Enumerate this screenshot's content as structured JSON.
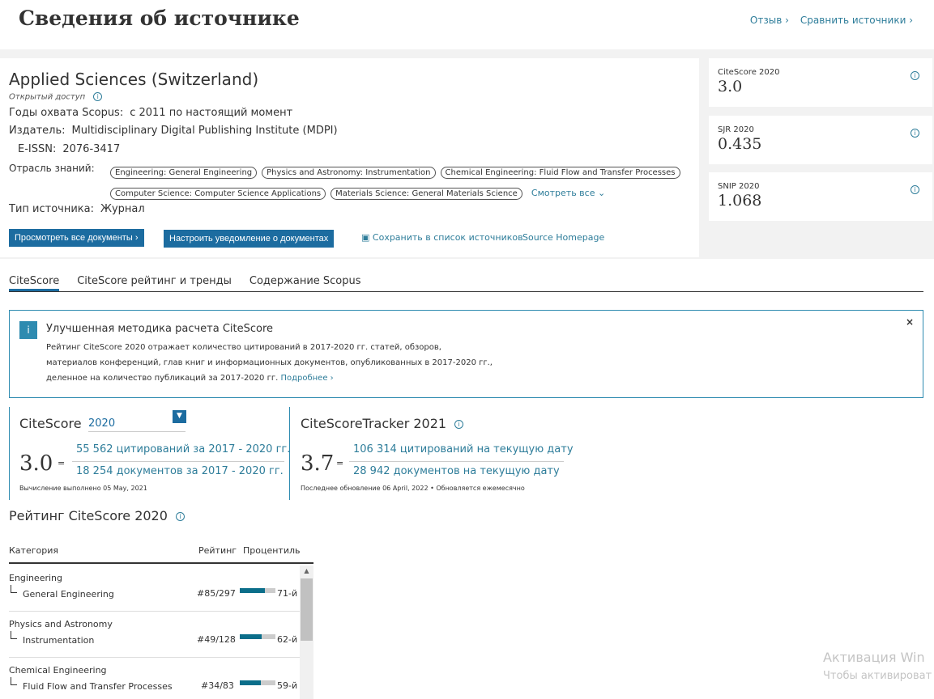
{
  "header": {
    "title": "Сведения об источнике",
    "feedback": "Отзыв",
    "compare": "Сравнить источники"
  },
  "source": {
    "title": "Applied Sciences (Switzerland)",
    "open_access": "Открытый доступ",
    "coverage_label": "Годы охвата Scopus:",
    "coverage_value": "с 2011 по настоящий момент",
    "publisher_label": "Издатель:",
    "publisher_value": "Multidisciplinary Digital Publishing Institute (MDPI)",
    "eissn_label": "E-ISSN:",
    "eissn_value": "2076-3417",
    "subject_label": "Отрасль знаний:",
    "subjects": [
      "Engineering: General Engineering",
      "Physics and Astronomy: Instrumentation",
      "Chemical Engineering: Fluid Flow and Transfer Processes",
      "Computer Science: Computer Science Applications",
      "Materials Science: General Materials Science"
    ],
    "see_all": "Смотреть все",
    "type_label": "Тип источника:",
    "type_value": "Журнал",
    "view_docs": "Просмотреть все документы",
    "set_alert": "Настроить уведомление о документах",
    "save_list": "Сохранить в список источников",
    "homepage": "Source Homepage"
  },
  "metrics": [
    {
      "label": "CiteScore 2020",
      "value": "3.0"
    },
    {
      "label": "SJR 2020",
      "value": "0.435"
    },
    {
      "label": "SNIP 2020",
      "value": "1.068"
    }
  ],
  "tabs": [
    "CiteScore",
    "CiteScore рейтинг и тренды",
    "Содержание Scopus"
  ],
  "notice": {
    "title": "Улучшенная методика расчета CiteScore",
    "line1": "Рейтинг CiteScore 2020 отражает количество цитирований в 2017-2020 гг. статей, обзоров,",
    "line2": "материалов конференций, глав книг и информационных документов, опубликованных в 2017-2020 гг.,",
    "line3": "деленное на количество публикаций за 2017-2020 гг.",
    "more": "Подробнее"
  },
  "citescore": {
    "title": "CiteScore",
    "year": "2020",
    "value": "3.0",
    "citations": "55 562 цитирований за 2017 - 2020 гг.",
    "documents": "18 254 документов за 2017 - 2020 гг.",
    "note": "Вычисление выполнено 05 May, 2021"
  },
  "tracker": {
    "title": "CiteScoreTracker 2021",
    "value": "3.7",
    "citations": "106 314 цитирований на текущую дату",
    "documents": "28 942 документов на текущую дату",
    "note": "Последнее обновление 06 April, 2022 • Обновляется ежемесячно"
  },
  "ranking": {
    "title": "Рейтинг CiteScore 2020",
    "col_category": "Категория",
    "col_rank": "Рейтинг",
    "col_percentile": "Процентиль",
    "rows": [
      {
        "category": "Engineering",
        "subcategory": "General Engineering",
        "rank": "#85/297",
        "percentile": 71,
        "percentile_label": "71-й"
      },
      {
        "category": "Physics and Astronomy",
        "subcategory": "Instrumentation",
        "rank": "#49/128",
        "percentile": 62,
        "percentile_label": "62-й"
      },
      {
        "category": "Chemical Engineering",
        "subcategory": "Fluid Flow and Transfer Processes",
        "rank": "#34/83",
        "percentile": 59,
        "percentile_label": "59-й"
      }
    ]
  },
  "watermark": {
    "line1": "Активация Win",
    "line2": "Чтобы активироват"
  },
  "colors": {
    "accent": "#1c6ca0",
    "link": "#2e7d9a",
    "bar_fill": "#0b6e8a"
  }
}
